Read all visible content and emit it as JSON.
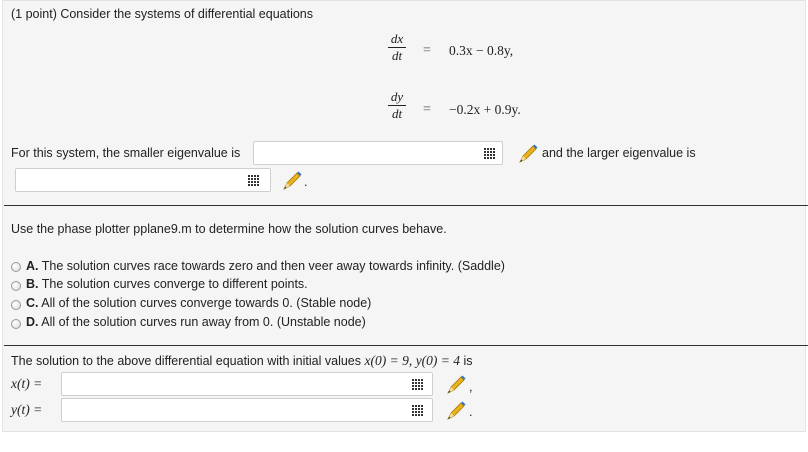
{
  "problem": {
    "header": "(1 point) Consider the systems of differential equations",
    "eq1": {
      "num": "dx",
      "den": "dt",
      "equals": "=",
      "rhs": "0.3x − 0.8y,"
    },
    "eq2": {
      "num": "dy",
      "den": "dt",
      "equals": "=",
      "rhs": "−0.2x + 0.9y."
    }
  },
  "eigen": {
    "smaller_label": "For this system, the smaller eigenvalue is",
    "larger_label": "and the larger eigenvalue is",
    "smaller_value": "",
    "larger_value": "",
    "trailing": "."
  },
  "phase": {
    "instruction": "Use the phase plotter pplane9.m to determine how the solution curves behave.",
    "options": [
      {
        "letter": "A.",
        "text": "The solution curves race towards zero and then veer away towards infinity. (Saddle)"
      },
      {
        "letter": "B.",
        "text": "The solution curves converge to different points."
      },
      {
        "letter": "C.",
        "text": "All of the solution curves converge towards 0. (Stable node)"
      },
      {
        "letter": "D.",
        "text": "All of the solution curves run away from 0. (Unstable node)"
      }
    ]
  },
  "solution": {
    "intro_text": "The solution to the above differential equation with initial values",
    "init1": "x(0) = 9,",
    "init2": "y(0) = 4",
    "intro_suffix": "is",
    "x_label": "x(t) =",
    "y_label": "y(t) =",
    "x_value": "",
    "y_value": "",
    "x_trailing": ",",
    "y_trailing": "."
  },
  "icons": {
    "grid": "matrix-grid-icon",
    "pencil": "pencil-icon"
  },
  "colors": {
    "panel_bg": "#f5f5f5",
    "pencil_yellow": "#e8b21a",
    "pencil_blue": "#3b6fc4"
  }
}
